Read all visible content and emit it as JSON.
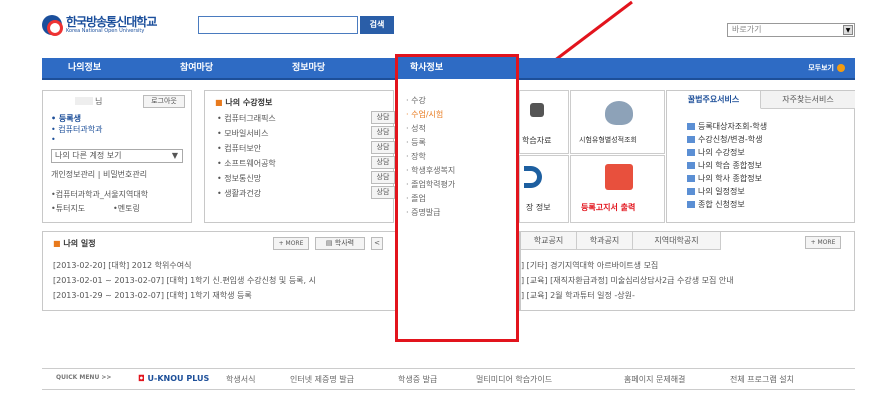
{
  "header": {
    "logo_text": "한국방송통신대학교",
    "logo_en": "Korea National Open University",
    "search_button": "검색",
    "search_value": "",
    "goto_label": "바로가기"
  },
  "nav": {
    "items": [
      "나의정보",
      "참여마당",
      "정보마당",
      "학사정보"
    ],
    "active": "학사정보",
    "all_label": "모두보기"
  },
  "login": {
    "name_suffix": "님",
    "logout": "로그아웃",
    "status": "등록생",
    "dept": "컴퓨터과학과",
    "account_select": "나의 다른 계정 보기",
    "links": [
      "개인정보관리",
      "비밀번호관리"
    ],
    "campus": "컴퓨터과학과_서울지역대학",
    "tutor": "튜터지도",
    "mentoring": "멘토링"
  },
  "courses": {
    "title": "나의 수강정보",
    "items": [
      "컴퓨터그래픽스",
      "모바일서비스",
      "컴퓨터보안",
      "소프트웨어공학",
      "정보통신망",
      "생활과건강"
    ],
    "btn": "상담"
  },
  "tiles": {
    "t1": "학습자료",
    "t2": "시험유형별성적조회",
    "t3": "장 정보",
    "t4": "등록고지서 출력"
  },
  "services": {
    "tab1": "꿀법주요서비스",
    "tab2": "자주찾는서비스",
    "items": [
      "등록대상자조회-학생",
      "수강신청/변경-학생",
      "나의 수강정보",
      "나의 학습 종합정보",
      "나의 학사 종합정보",
      "나의 일정정보",
      "종합 신청정보"
    ]
  },
  "schedule": {
    "title": "나의 일정",
    "more": "+ MORE",
    "calendar": "학사력",
    "items": [
      "[2013-02-20] [대학] 2012 학위수여식",
      "[2013-02-01 ~ 2013-02-07] [대학] 1학기 신.편입생 수강신청 및 등록, 시",
      "[2013-01-29 ~ 2013-02-07] [대학] 1학기 재학생 등록"
    ]
  },
  "notice": {
    "tabs": [
      "학교공지",
      "학과공지",
      "지역대학공지"
    ],
    "more": "+ MORE",
    "items": [
      "] [기타] 경기지역대학 아르바이트생 모집",
      "] [교육] [재직자환급과정] 미술심리상담사2급 수강생 모집 안내",
      "] [교육] 2월 학과튜터 일정 -상원-"
    ]
  },
  "dropdown": {
    "title": "학사정보",
    "items": [
      "수강",
      "수업/시험",
      "성적",
      "등록",
      "장학",
      "학생후생복지",
      "졸업학력평가",
      "졸업",
      "증명발급"
    ],
    "active": "수업/시험"
  },
  "quick": {
    "label": "QUICK MENU >>",
    "plus": "U-KNOU PLUS",
    "links": [
      "학생서식",
      "인터넷 제증명 발급",
      "학생증 발급",
      "멀티미디어 학습가이드",
      "홈페이지 문제해결",
      "전체 프로그램 설치"
    ]
  },
  "colors": {
    "nav_blue": "#2e6bc4",
    "highlight_red": "#e2141d",
    "accent_orange": "#e87a1d"
  }
}
